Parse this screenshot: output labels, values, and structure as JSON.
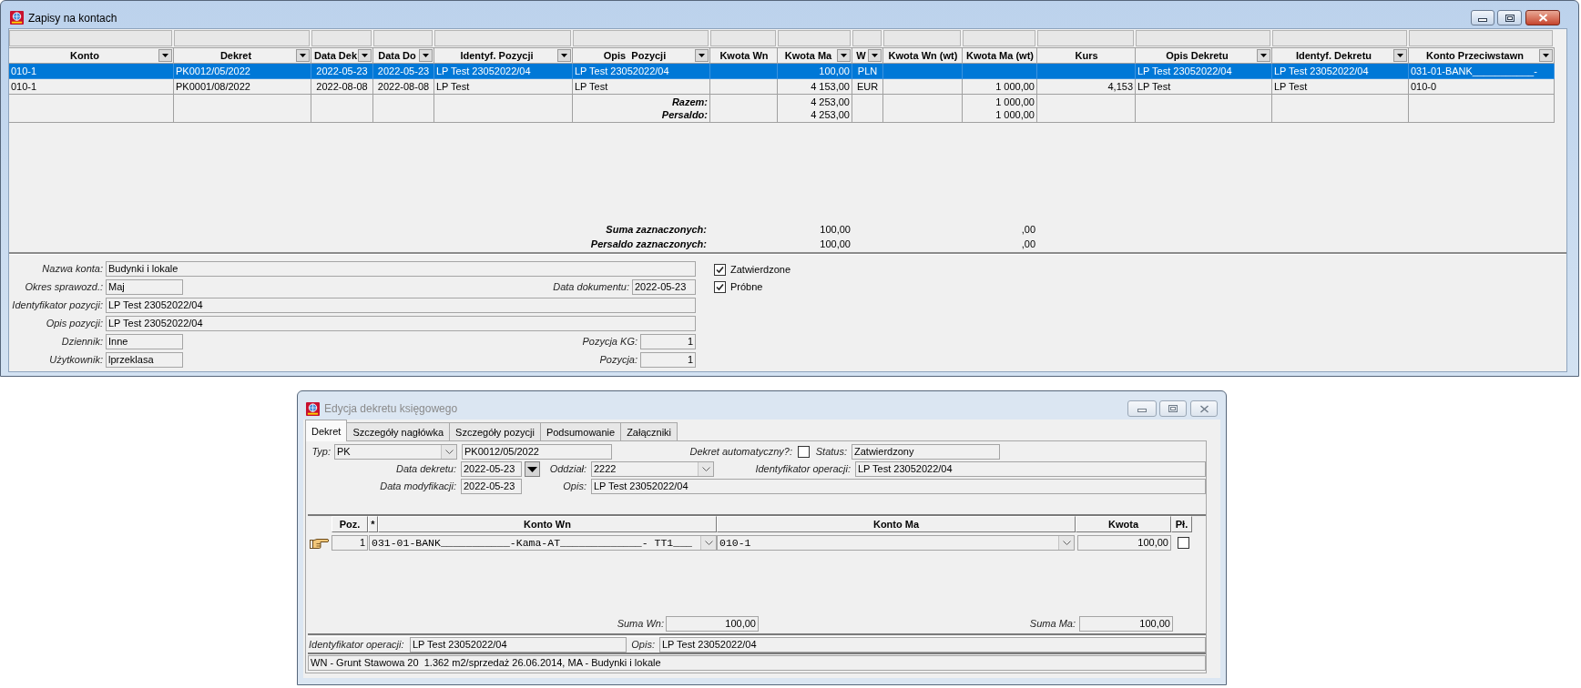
{
  "main_window": {
    "title": "Zapisy na kontach",
    "active": true,
    "grid": {
      "columns": [
        {
          "label": "Konto",
          "filter_button": true
        },
        {
          "label": "Dekret",
          "filter_button": true
        },
        {
          "label": "Data Dek",
          "filter_button": true
        },
        {
          "label": "Data Do",
          "filter_button": true
        },
        {
          "label": "Identyf. Pozycji",
          "filter_button": true
        },
        {
          "label": "Opis  Pozycji",
          "filter_button": true
        },
        {
          "label": "Kwota Wn",
          "filter_button": false
        },
        {
          "label": "Kwota Ma",
          "filter_button": true
        },
        {
          "label": "W",
          "filter_button": true
        },
        {
          "label": "Kwota Wn (wt)",
          "filter_button": false
        },
        {
          "label": "Kwota Ma (wt)",
          "filter_button": false
        },
        {
          "label": "Kurs",
          "filter_button": false
        },
        {
          "label": "Opis Dekretu",
          "filter_button": true
        },
        {
          "label": "Identyf. Dekretu",
          "filter_button": true
        },
        {
          "label": "Konto Przeciwstawn",
          "filter_button": true
        }
      ],
      "rows": [
        {
          "selected": true,
          "konto": "010-1",
          "dekret": "PK0012/05/2022",
          "data_dek": "2022-05-23",
          "data_do": "2022-05-23",
          "identyf_pozycji": "LP Test 23052022/04",
          "opis_pozycji": "LP Test 23052022/04",
          "kwota_ma": "100,00",
          "w": "PLN",
          "opis_dekretu": "LP Test 23052022/04",
          "identyf_dekretu": "LP Test 23052022/04",
          "konto_przeciwstawn": "031-01-BANK___________-"
        },
        {
          "selected": false,
          "konto": "010-1",
          "dekret": "PK0001/08/2022",
          "data_dek": "2022-08-08",
          "data_do": "2022-08-08",
          "identyf_pozycji": "LP Test",
          "opis_pozycji": "LP Test",
          "kwota_ma": "4 153,00",
          "w": "EUR",
          "kwota_ma_wt": "1 000,00",
          "kurs": "4,153",
          "opis_dekretu": "LP Test",
          "identyf_dekretu": "LP Test",
          "konto_przeciwstawn": "010-0"
        }
      ],
      "totals": [
        {
          "label": "Razem:",
          "kwota_ma": "4 253,00",
          "kwota_ma_wt": "1 000,00"
        },
        {
          "label": "Persaldo:",
          "kwota_ma": "4 253,00",
          "kwota_ma_wt": "1 000,00"
        }
      ],
      "selection_totals": [
        {
          "label": "Suma zaznaczonych:",
          "kwota_ma": "100,00",
          "kwota_ma_wt": ",00"
        },
        {
          "label": "Persaldo zaznaczonych:",
          "kwota_ma": "100,00",
          "kwota_ma_wt": ",00"
        }
      ]
    },
    "form": {
      "rows": [
        {
          "fields": [
            {
              "label": "Nazwa konta:",
              "value": "Budynki i lokale",
              "kind": "wide"
            }
          ]
        },
        {
          "fields": [
            {
              "label": "Okres sprawozd.:",
              "value": "Maj",
              "kind": "short"
            },
            {
              "label": "Data dokumentu:",
              "value": "2022-05-23",
              "kind": "date"
            }
          ]
        },
        {
          "fields": [
            {
              "label": "Identyfikator pozycji:",
              "value": "LP Test 23052022/04",
              "kind": "wide"
            }
          ]
        },
        {
          "fields": [
            {
              "label": "Opis pozycji:",
              "value": "LP Test 23052022/04",
              "kind": "wide"
            }
          ]
        },
        {
          "fields": [
            {
              "label": "Dziennik:",
              "value": "Inne",
              "kind": "short"
            },
            {
              "label": "Pozycja KG:",
              "value": "1",
              "kind": "number"
            }
          ]
        },
        {
          "fields": [
            {
              "label": "Użytkownik:",
              "value": "lprzeklasa",
              "kind": "short"
            },
            {
              "label": "Pozycja:",
              "value": "1",
              "kind": "number"
            }
          ]
        }
      ],
      "checkboxes": [
        {
          "label": "Zatwierdzone",
          "checked": true
        },
        {
          "label": "Próbne",
          "checked": true
        }
      ]
    }
  },
  "dialog": {
    "title": "Edycja dekretu księgowego",
    "active": false,
    "tabs": [
      {
        "label": "Dekret",
        "selected": true
      },
      {
        "label": "Szczegóły nagłówka",
        "selected": false
      },
      {
        "label": "Szczegóły pozycji",
        "selected": false
      },
      {
        "label": "Podsumowanie",
        "selected": false
      },
      {
        "label": "Załączniki",
        "selected": false
      }
    ],
    "header": {
      "typ": {
        "label": "Typ:",
        "value": "PK"
      },
      "numer": {
        "value": "PK0012/05/2022"
      },
      "dekret_automatyczny": {
        "label": "Dekret automatyczny?:",
        "checked": false
      },
      "status": {
        "label": "Status:",
        "value": "Zatwierdzony"
      },
      "data_dekretu": {
        "label": "Data dekretu:",
        "value": "2022-05-23"
      },
      "oddzial": {
        "label": "Oddział:",
        "value": "2222"
      },
      "identyfikator_operacji": {
        "label": "Identyfikator operacji:",
        "value": "LP Test 23052022/04"
      },
      "data_modyfikacji": {
        "label": "Data modyfikacji:",
        "value": "2022-05-23"
      },
      "opis": {
        "label": "Opis:",
        "value": "LP Test 23052022/04"
      }
    },
    "lines": {
      "columns": [
        "Poz.",
        "*",
        "Konto Wn",
        "Konto Ma",
        "Kwota",
        "Pł."
      ],
      "rows": [
        {
          "current": true,
          "poz": "1",
          "konto_wn": "031-01-BANK___________-Kama-AT_____________- TT1___",
          "konto_ma": "010-1",
          "kwota": "100,00",
          "pl": {
            "checked": false
          }
        }
      ],
      "sums": [
        {
          "label": "Suma Wn:",
          "value": "100,00"
        },
        {
          "label": "Suma Ma:",
          "value": "100,00"
        }
      ]
    },
    "footer": {
      "identyfikator_operacji": {
        "label": "Identyfikator operacji:",
        "value": "LP Test 23052022/04"
      },
      "opis": {
        "label": "Opis:",
        "value": "LP Test 23052022/04"
      },
      "description": "WN - Grunt Stawowa 20  1.362 m2/sprzedaż 26.06.2014, MA - Budynki i lokale"
    }
  }
}
